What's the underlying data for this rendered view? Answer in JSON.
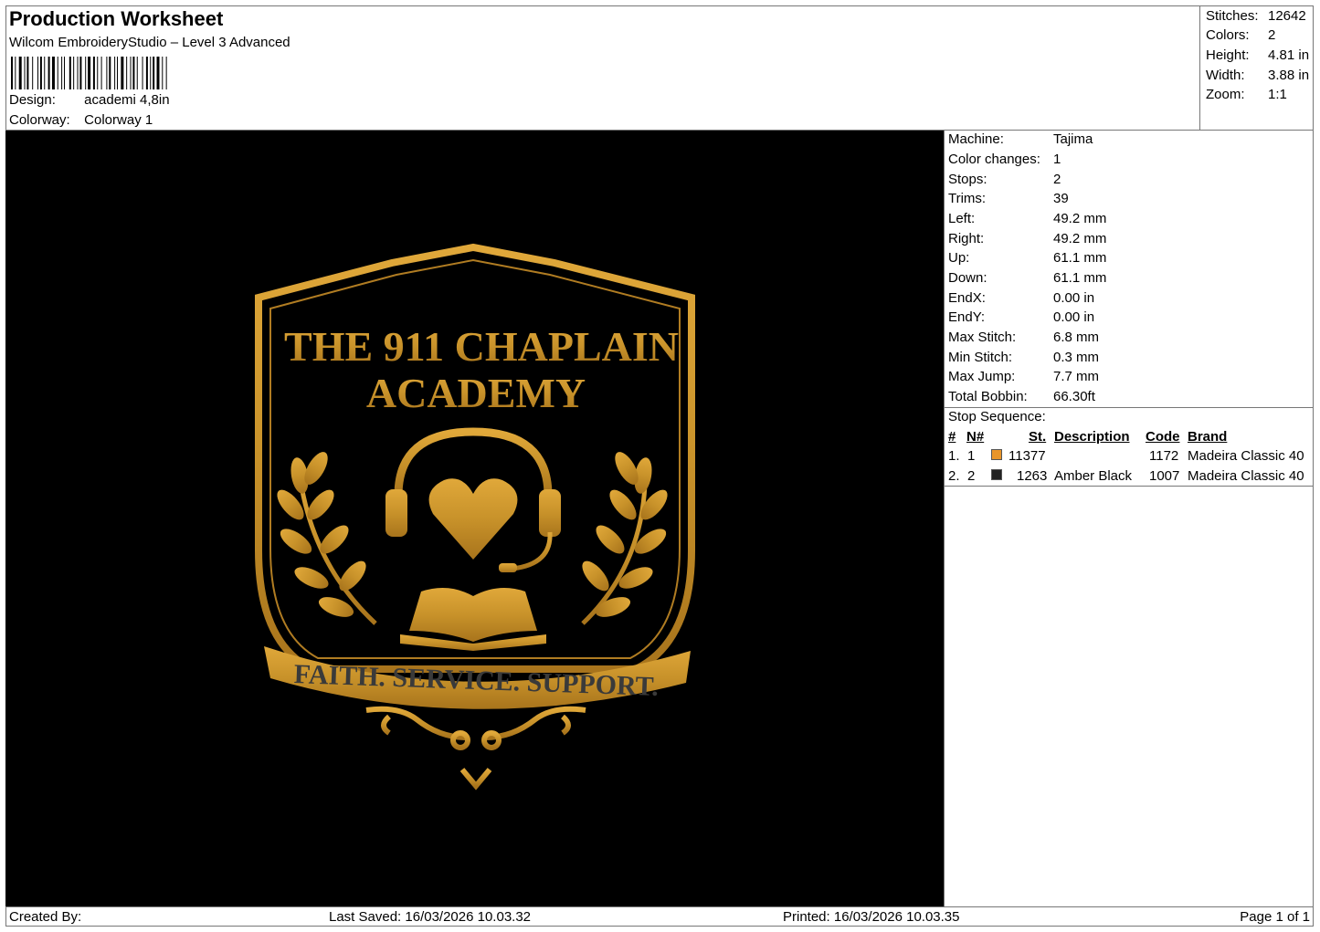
{
  "header": {
    "title": "Production Worksheet",
    "software": "Wilcom EmbroideryStudio – Level 3 Advanced",
    "design_label": "Design:",
    "design_value": "academi 4,8in",
    "colorway_label": "Colorway:",
    "colorway_value": "Colorway 1"
  },
  "summary": [
    {
      "label": "Stitches:",
      "value": "12642"
    },
    {
      "label": "Colors:",
      "value": "2"
    },
    {
      "label": "Height:",
      "value": "4.81 in"
    },
    {
      "label": "Width:",
      "value": "3.88 in"
    },
    {
      "label": "Zoom:",
      "value": "1:1"
    }
  ],
  "machine_info": [
    {
      "label": "Machine:",
      "value": "Tajima"
    },
    {
      "label": "Color changes:",
      "value": "1"
    },
    {
      "label": "Stops:",
      "value": "2"
    },
    {
      "label": "Trims:",
      "value": "39"
    },
    {
      "label": "Left:",
      "value": "49.2 mm"
    },
    {
      "label": "Right:",
      "value": "49.2 mm"
    },
    {
      "label": "Up:",
      "value": "61.1 mm"
    },
    {
      "label": "Down:",
      "value": "61.1 mm"
    },
    {
      "label": "EndX:",
      "value": "0.00 in"
    },
    {
      "label": "EndY:",
      "value": "0.00 in"
    },
    {
      "label": "Max Stitch:",
      "value": "6.8 mm"
    },
    {
      "label": "Min Stitch:",
      "value": "0.3 mm"
    },
    {
      "label": "Max Jump:",
      "value": "7.7 mm"
    },
    {
      "label": "Total Bobbin:",
      "value": "66.30ft"
    }
  ],
  "stop_sequence": {
    "title": "Stop Sequence:",
    "columns": [
      "#",
      "N#",
      "St.",
      "Description",
      "Code",
      "Brand"
    ],
    "rows": [
      {
        "num": "1.",
        "n": "1",
        "color": "#E8952A",
        "st": "11377",
        "description": "",
        "code": "1172",
        "brand": "Madeira Classic 40"
      },
      {
        "num": "2.",
        "n": "2",
        "color": "#222222",
        "st": "1263",
        "description": "Amber Black",
        "code": "1007",
        "brand": "Madeira Classic 40"
      }
    ]
  },
  "design_preview": {
    "line1": "THE 911 CHAPLAIN",
    "line2": "ACADEMY",
    "banner": "FAITH. SERVICE. SUPPORT.",
    "thread_gold": "#C8922A",
    "thread_dark": "#3A3A3A"
  },
  "footer": {
    "created_by": "Created By:",
    "last_saved": "Last Saved: 16/03/2026 10.03.32",
    "printed": "Printed: 16/03/2026 10.03.35",
    "page": "Page 1 of 1"
  }
}
